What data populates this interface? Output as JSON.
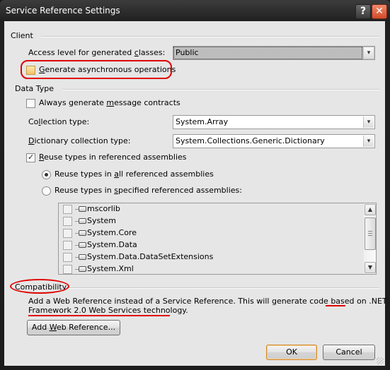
{
  "window": {
    "title": "Service Reference Settings",
    "help_label": "?",
    "close_label": "✕"
  },
  "client": {
    "group_label": "Client",
    "access_level_label": "Access level for generated classes:",
    "access_level_value": "Public",
    "async_label": "Generate asynchronous operations",
    "async_checked": false
  },
  "data_type": {
    "group_label": "Data Type",
    "message_contracts_label": "Always generate message contracts",
    "message_contracts_checked": false,
    "collection_type_label": "Collection type:",
    "collection_type_value": "System.Array",
    "dictionary_type_label": "Dictionary collection type:",
    "dictionary_type_value": "System.Collections.Generic.Dictionary",
    "reuse_types_label": "Reuse types in referenced assemblies",
    "reuse_types_checked": true,
    "reuse_all_label": "Reuse types in all referenced assemblies",
    "reuse_all_selected": true,
    "reuse_specified_label": "Reuse types in specified referenced assemblies:",
    "reuse_specified_selected": false,
    "assemblies": [
      {
        "name": "mscorlib",
        "checked": false
      },
      {
        "name": "System",
        "checked": false
      },
      {
        "name": "System.Core",
        "checked": false
      },
      {
        "name": "System.Data",
        "checked": false
      },
      {
        "name": "System.Data.DataSetExtensions",
        "checked": false
      },
      {
        "name": "System.Xml",
        "checked": false
      }
    ]
  },
  "compatibility": {
    "group_label": "Compatibility",
    "description_line1": "Add a Web Reference instead of a Service Reference. This will generate code based on .NET",
    "description_line2": "Framework 2.0 Web Services technology.",
    "add_web_reference_label": "Add Web Reference..."
  },
  "footer": {
    "ok_label": "OK",
    "cancel_label": "Cancel"
  },
  "icons": {
    "dropdown": "▾",
    "scroll_up": "▲",
    "scroll_down": "▼"
  },
  "colors": {
    "annotation": "#e00000",
    "default_button_border": "#d08a30"
  }
}
